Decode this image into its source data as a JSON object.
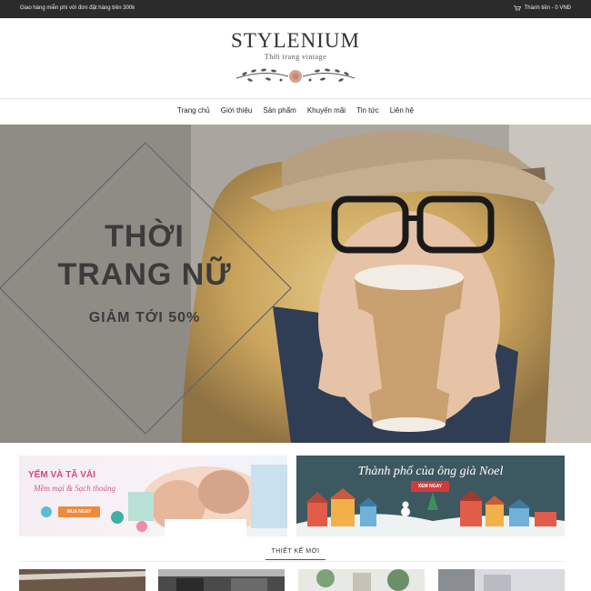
{
  "topbar": {
    "promo_text": "Giao hàng miễn phí với đơn đặt hàng trên 300k",
    "cart_text": "Thành tiền - 0 VNĐ"
  },
  "header": {
    "logo": "STYLENIUM",
    "tagline": "Thời trang vintage"
  },
  "nav": {
    "items": [
      "Trang chủ",
      "Giới thiệu",
      "Sản phẩm",
      "Khuyến mãi",
      "Tin tức",
      "Liên hệ"
    ]
  },
  "hero": {
    "line1": "THỜI",
    "line2": "TRANG NỮ",
    "line3": "GIẢM TỚI 50%"
  },
  "banners": {
    "left": {
      "title": "YẾM VÀ TÃ VẢI",
      "subtitle": "Mềm mại & Sạch thoáng",
      "button": "MUA NGAY"
    },
    "right": {
      "title": "Thành phố của ông già Noel",
      "button": "XEM NGAY"
    }
  },
  "section": {
    "title": "THIẾT KẾ MỚI"
  }
}
